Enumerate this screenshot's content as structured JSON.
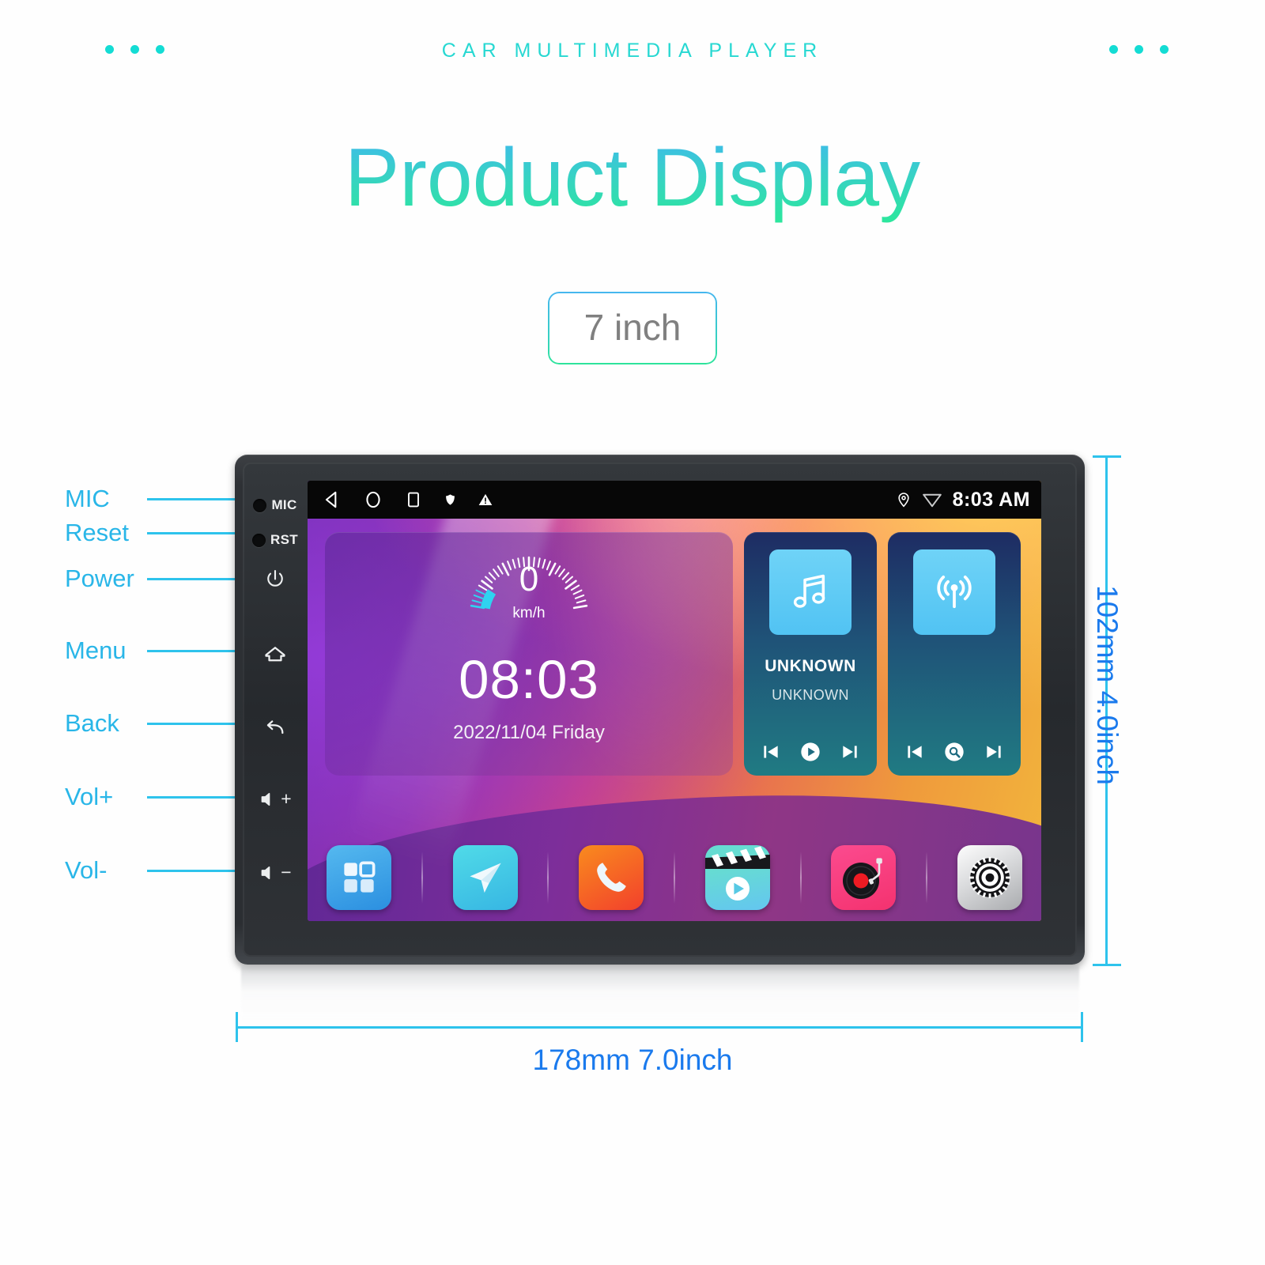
{
  "header": {
    "eyebrow": "CAR MULTIMEDIA PLAYER",
    "title": "Product Display",
    "size_badge": "7 inch",
    "accent_cyan": "#14dcd4",
    "title_gradient_from": "#3fb8f0",
    "title_gradient_to": "#2ce79c"
  },
  "callouts": [
    {
      "label": "MIC",
      "icon": "mic-hole-icon"
    },
    {
      "label": "Reset",
      "icon": "reset-hole-icon"
    },
    {
      "label": "Power",
      "icon": "power-icon"
    },
    {
      "label": "Menu",
      "icon": "home-icon"
    },
    {
      "label": "Back",
      "icon": "back-arrow-icon"
    },
    {
      "label": "Vol+",
      "icon": "volume-up-icon"
    },
    {
      "label": "Vol-",
      "icon": "volume-down-icon"
    }
  ],
  "side_panel": {
    "mic_label": "MIC",
    "rst_label": "RST",
    "vol_up": "+",
    "vol_down": "−"
  },
  "screen": {
    "statusbar": {
      "nav_back": "back-triangle-icon",
      "nav_home": "home-circle-icon",
      "nav_recents": "recents-square-icon",
      "shield": "shield-icon",
      "warning": "warning-triangle-icon",
      "location": "location-pin-icon",
      "wifi": "wifi-icon",
      "time": "8:03 AM"
    },
    "speed_widget": {
      "speed_value": "0",
      "speed_unit": "km/h",
      "clock": "08:03",
      "date": "2022/11/04  Friday"
    },
    "music_widget": {
      "icon": "music-note-icon",
      "title": "UNKNOWN",
      "subtitle": "UNKNOWN",
      "controls": [
        "previous-icon",
        "play-icon",
        "next-icon"
      ]
    },
    "radio_widget": {
      "icon": "radio-antenna-icon",
      "controls": [
        "previous-icon",
        "scan-search-icon",
        "next-icon"
      ]
    },
    "dock": [
      {
        "name": "apps-grid-app",
        "label": "Apps"
      },
      {
        "name": "navigation-app",
        "label": "Navigation"
      },
      {
        "name": "phone-app",
        "label": "Phone"
      },
      {
        "name": "video-app",
        "label": "Video"
      },
      {
        "name": "music-app",
        "label": "Music"
      },
      {
        "name": "settings-app",
        "label": "Settings"
      }
    ]
  },
  "dimensions": {
    "height": "102mm 4.0inch",
    "width": "178mm 7.0inch",
    "color": "#1a7aed",
    "line_color": "#2ec3ec"
  }
}
